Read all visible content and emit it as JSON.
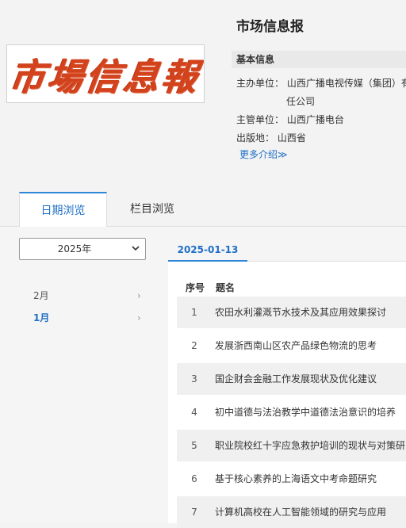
{
  "header": {
    "logo_text": "市場信息報",
    "title": "市场信息报"
  },
  "info": {
    "heading": "基本信息",
    "sponsor_label": "主办单位：",
    "sponsor_value_line1": "山西广播电视传媒（集团）有",
    "sponsor_value_line2": "任公司",
    "supervisor_label": "主管单位：",
    "supervisor_value": "山西广播电台",
    "place_label": "出版地：",
    "place_value": "山西省",
    "more_label": "更多介绍≫"
  },
  "tabs": [
    {
      "label": "日期浏览",
      "active": true
    },
    {
      "label": "栏目浏览",
      "active": false
    }
  ],
  "sidebar": {
    "year_selected": "2025年",
    "months": [
      {
        "label": "2月",
        "active": false
      },
      {
        "label": "1月",
        "active": true
      }
    ]
  },
  "issue": {
    "date_tab": "2025-01-13",
    "columns": [
      "序号",
      "题名"
    ],
    "rows": [
      {
        "no": "1",
        "title": "农田水利灌溉节水技术及其应用效果探讨"
      },
      {
        "no": "2",
        "title": "发展浙西南山区农产品绿色物流的思考"
      },
      {
        "no": "3",
        "title": "国企财会金融工作发展现状及优化建议"
      },
      {
        "no": "4",
        "title": "初中道德与法治教学中道德法治意识的培养"
      },
      {
        "no": "5",
        "title": "职业院校红十字应急救护培训的现状与对策研"
      },
      {
        "no": "6",
        "title": "基于核心素养的上海语文中考命题研究"
      },
      {
        "no": "7",
        "title": "计算机高校在人工智能领域的研究与应用"
      }
    ]
  },
  "colors": {
    "accent": "#1f6fc6",
    "logo_red": "#d2431d",
    "row_shade": "#f0f0f0"
  }
}
